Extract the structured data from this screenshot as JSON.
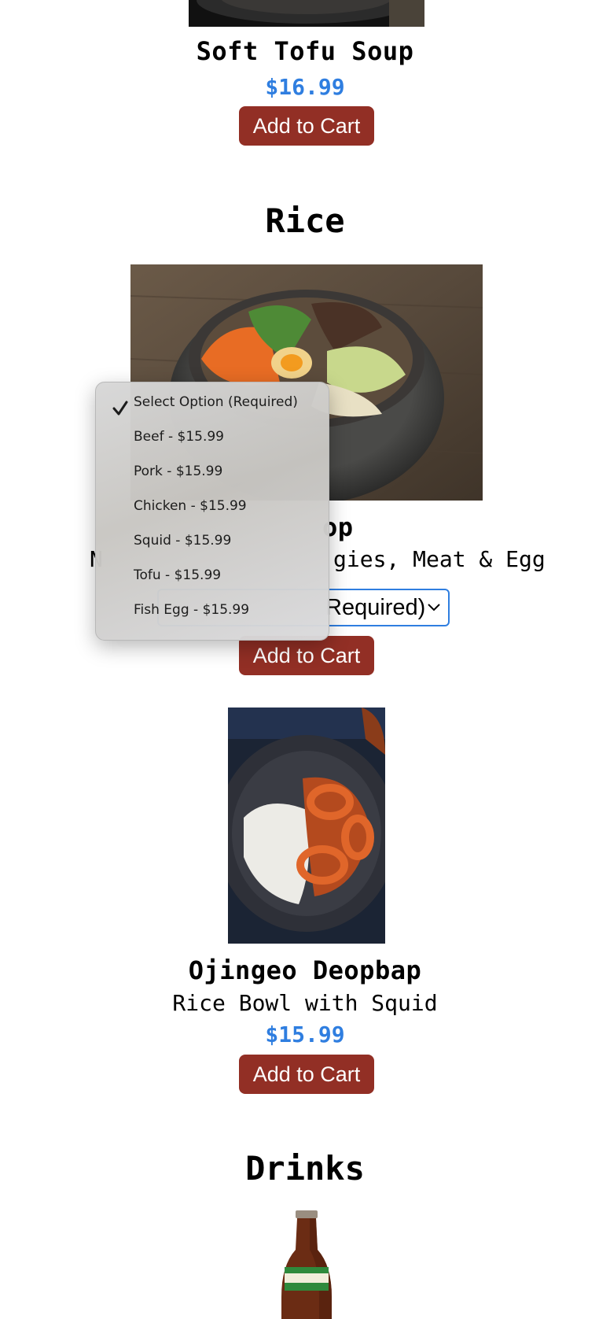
{
  "soup_item": {
    "name": "Soft Tofu Soup",
    "price": "$16.99",
    "add_label": "Add to Cart"
  },
  "rice_section": {
    "title": "Rice",
    "bibimbap": {
      "name_visible": "op",
      "desc_left": "N",
      "desc_right": "gies, Meat & Egg",
      "select_value": "Required)",
      "add_label": "Add to Cart"
    },
    "ojingeo": {
      "name": "Ojingeo Deopbap",
      "desc": "Rice Bowl with Squid",
      "price": "$15.99",
      "add_label": "Add to Cart"
    }
  },
  "drinks_section": {
    "title": "Drinks"
  },
  "dropdown": {
    "selected_index": 0,
    "options": [
      "Select Option (Required)",
      "Beef - $15.99",
      "Pork - $15.99",
      "Chicken - $15.99",
      "Squid - $15.99",
      "Tofu - $15.99",
      "Fish Egg - $15.99"
    ]
  },
  "colors": {
    "price_blue": "#2f7ee0",
    "button_red": "#922f25"
  }
}
